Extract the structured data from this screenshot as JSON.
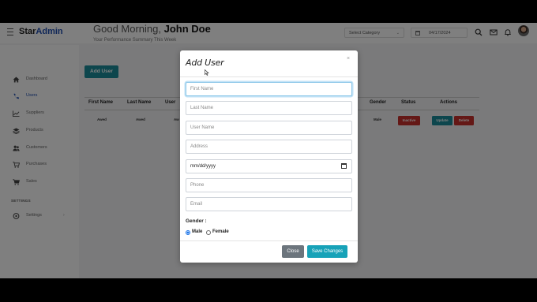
{
  "brand": {
    "prefix": "Star",
    "name": "Admin"
  },
  "header": {
    "greeting": "Good Morning,",
    "user": "John Doe",
    "subtitle": "Your Performance Summary This Week",
    "category_placeholder": "Select Category",
    "date": "04/17/2024"
  },
  "sidebar": {
    "items": [
      {
        "label": "Dashboard",
        "icon": "home-icon"
      },
      {
        "label": "Users",
        "icon": "phone-icon",
        "active": true
      },
      {
        "label": "Suppliers",
        "icon": "chart-icon"
      },
      {
        "label": "Products",
        "icon": "layers-icon"
      },
      {
        "label": "Customers",
        "icon": "users-icon"
      },
      {
        "label": "Purchases",
        "icon": "cart-icon"
      },
      {
        "label": "Sales",
        "icon": "cart-icon"
      }
    ],
    "section_label": "SETTINGS",
    "settings_item": {
      "label": "Settings",
      "icon": "settings-icon"
    }
  },
  "main": {
    "add_button": "Add User",
    "columns": [
      "First Name",
      "Last Name",
      "User",
      "Gender",
      "Status",
      "Actions"
    ],
    "row": {
      "first_name": "Awed",
      "last_name": "Awed",
      "user": "Aw",
      "gender": "Male",
      "status": "Inactive",
      "update": "Update",
      "delete": "Delete"
    }
  },
  "modal": {
    "title": "Add User",
    "close_symbol": "×",
    "fields": {
      "first_name": "First Name",
      "last_name": "Last Name",
      "user_name": "User Name",
      "address": "Address",
      "date": "mm/dd/yyyy",
      "phone": "Phone",
      "email": "Email"
    },
    "gender_label": "Gender :",
    "gender_options": [
      "Male",
      "Female"
    ],
    "gender_selected": "Male",
    "close_button": "Close",
    "save_button": "Save Changes"
  },
  "colors": {
    "brand_blue": "#1e4db0",
    "teal": "#1a8d9a",
    "danger": "#c9302c",
    "secondary": "#6c757d",
    "info": "#17a2b8"
  }
}
